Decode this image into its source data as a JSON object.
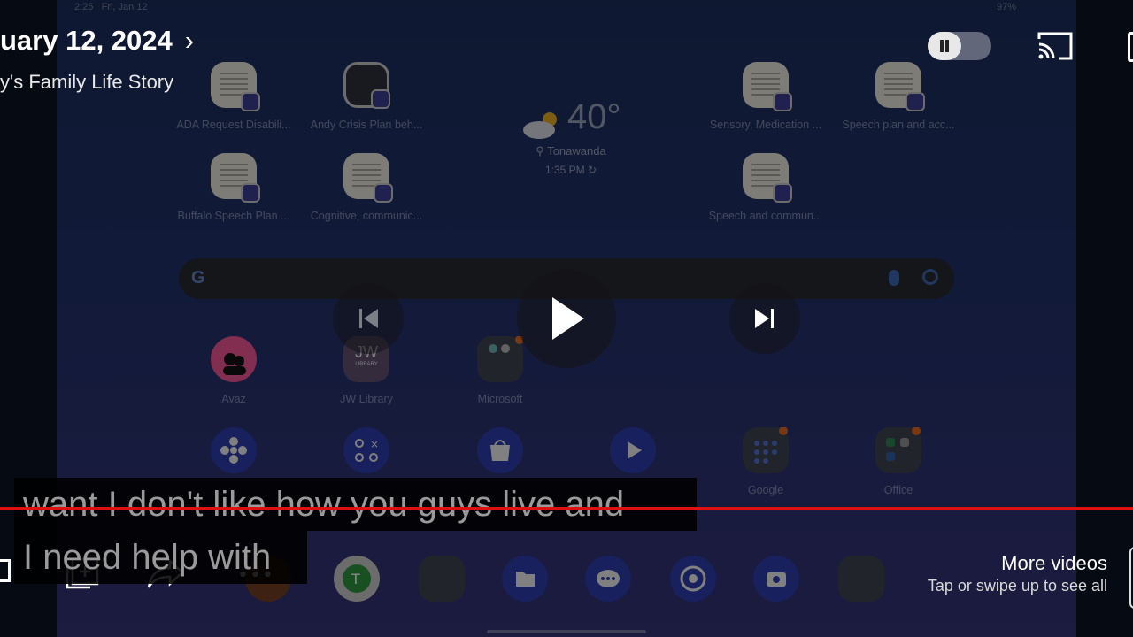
{
  "player": {
    "title_fragment": "uary 12, 2024",
    "title_arrow": "›",
    "subtitle_fragment": "y's Family Life Story",
    "caption_line1": "want I don't like how you guys live and",
    "caption_line2": "I need help with",
    "more_videos_title": "More videos",
    "more_videos_sub": "Tap or swipe up to see all",
    "progress_color": "#e01010",
    "autoplay_toggle": "on"
  },
  "tablet": {
    "status_time": "2:25",
    "status_date": "Fri, Jan 12",
    "status_battery": "97%",
    "weather": {
      "temp": "40°",
      "location": "Tonawanda",
      "updated": "1:35 PM"
    },
    "search_logo": "G",
    "doc_apps": [
      {
        "label": "ADA Request Disabili..."
      },
      {
        "label": "Andy Crisis Plan beh..."
      },
      {
        "label": "Sensory, Medication ..."
      },
      {
        "label": "Speech plan and acc..."
      },
      {
        "label": "Buffalo Speech Plan ..."
      },
      {
        "label": "Cognitive, communic..."
      },
      {
        "label": "Speech and commun..."
      }
    ],
    "row_apps": [
      {
        "label": "Avaz"
      },
      {
        "label": "JW Library"
      },
      {
        "label": "Microsoft"
      }
    ],
    "jw_icon_text": "JW",
    "jw_icon_sub": "LIBRARY",
    "folder_apps": [
      {
        "label": "Google"
      },
      {
        "label": "Office"
      }
    ],
    "icons": {
      "weather": "cloud-sun-icon",
      "location": "location-pin-icon",
      "refresh": "refresh-icon"
    }
  }
}
